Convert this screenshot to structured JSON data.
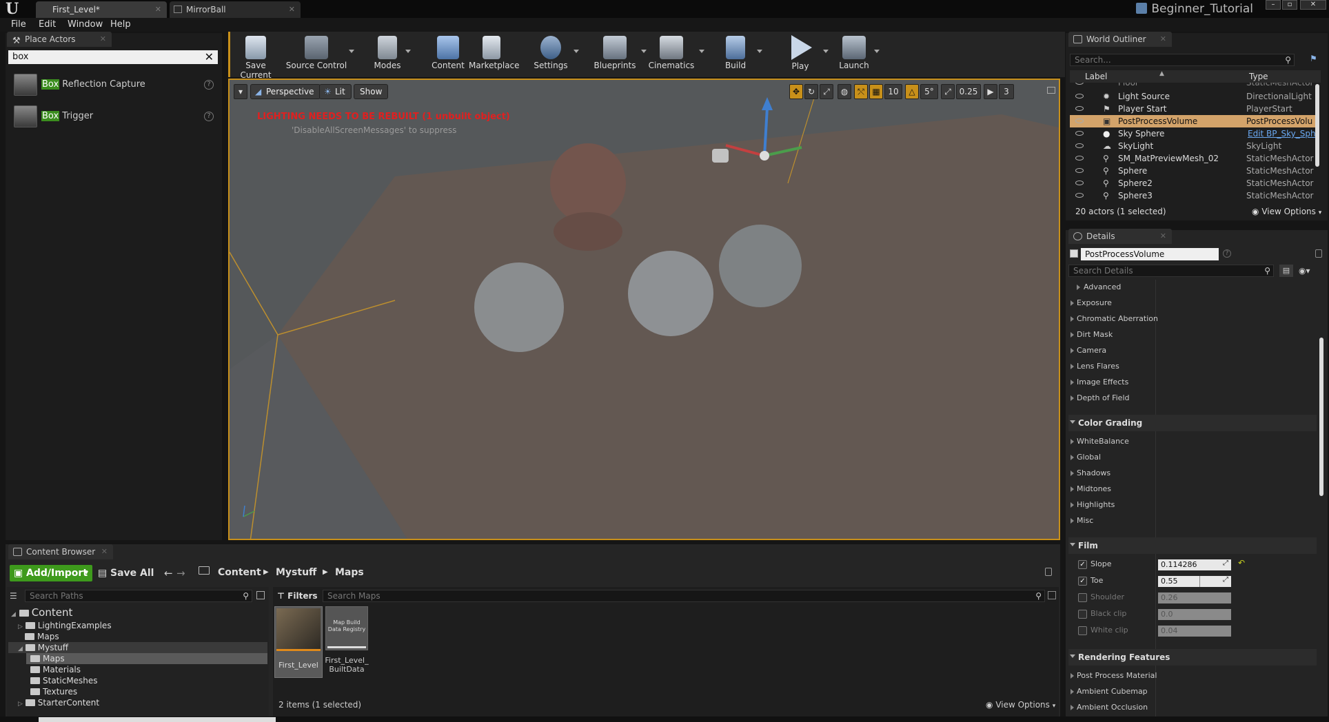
{
  "window": {
    "tabs": [
      {
        "label": "First_Level*"
      },
      {
        "label": "MirrorBall"
      }
    ],
    "project_name": "Beginner_Tutorial"
  },
  "menu": [
    "File",
    "Edit",
    "Window",
    "Help"
  ],
  "place_actors": {
    "tab_label": "Place Actors",
    "search_value": "box",
    "items": [
      {
        "highlight": "Box",
        "rest": " Reflection Capture"
      },
      {
        "highlight": "Box",
        "rest": " Trigger"
      }
    ]
  },
  "toolbar": {
    "buttons": [
      "Save Current",
      "Source Control",
      "Modes",
      "Content",
      "Marketplace",
      "Settings",
      "Blueprints",
      "Cinematics",
      "Build",
      "Play",
      "Launch"
    ]
  },
  "viewport": {
    "perspective_label": "Perspective",
    "lit_label": "Lit",
    "show_label": "Show",
    "warning": "LIGHTING NEEDS TO BE REBUILT (1 unbuilt object)",
    "suppress_hint": "'DisableAllScreenMessages' to suppress",
    "grid_snap": "10",
    "rotation_snap": "5°",
    "scale_snap": "0.25",
    "camera_speed": "3"
  },
  "content_browser": {
    "tab_label": "Content Browser",
    "add_import_label": "Add/Import",
    "save_all_label": "Save All",
    "breadcrumb": [
      "Content",
      "Mystuff",
      "Maps"
    ],
    "search_paths_placeholder": "Search Paths",
    "filters_label": "Filters",
    "search_maps_placeholder": "Search Maps",
    "tree": [
      {
        "label": "Content",
        "depth": 0
      },
      {
        "label": "LightingExamples",
        "depth": 1
      },
      {
        "label": "Maps",
        "depth": 1
      },
      {
        "label": "Mystuff",
        "depth": 1
      },
      {
        "label": "Maps",
        "depth": 2
      },
      {
        "label": "Materials",
        "depth": 2
      },
      {
        "label": "StaticMeshes",
        "depth": 2
      },
      {
        "label": "Textures",
        "depth": 2
      },
      {
        "label": "StarterContent",
        "depth": 1
      }
    ],
    "assets": [
      {
        "name": "First_Level"
      },
      {
        "thumb_label": "Map Build Data Registry",
        "name": "First_Level_ BuiltData"
      }
    ],
    "item_count": "2 items (1 selected)",
    "view_options_label": "View Options"
  },
  "world_outliner": {
    "tab_label": "World Outliner",
    "search_placeholder": "Search...",
    "col_label": "Label",
    "col_type": "Type",
    "rows": [
      {
        "label": "Floor",
        "type": "StaticMeshActor"
      },
      {
        "label": "Light Source",
        "type": "DirectionalLight"
      },
      {
        "label": "Player Start",
        "type": "PlayerStart"
      },
      {
        "label": "PostProcessVolume",
        "type": "PostProcessVolu"
      },
      {
        "label": "Sky Sphere",
        "type": "Edit BP_Sky_Sph"
      },
      {
        "label": "SkyLight",
        "type": "SkyLight"
      },
      {
        "label": "SM_MatPreviewMesh_02",
        "type": "StaticMeshActor"
      },
      {
        "label": "Sphere",
        "type": "StaticMeshActor"
      },
      {
        "label": "Sphere2",
        "type": "StaticMeshActor"
      },
      {
        "label": "Sphere3",
        "type": "StaticMeshActor"
      }
    ],
    "footer": "20 actors (1 selected)",
    "view_options_label": "View Options"
  },
  "details": {
    "tab_label": "Details",
    "object_name": "PostProcessVolume",
    "search_placeholder": "Search Details",
    "items_top": [
      "Advanced",
      "Exposure",
      "Chromatic Aberration",
      "Dirt Mask",
      "Camera",
      "Lens Flares",
      "Image Effects",
      "Depth of Field"
    ],
    "color_grading_label": "Color Grading",
    "color_grading_items": [
      "WhiteBalance",
      "Global",
      "Shadows",
      "Midtones",
      "Highlights",
      "Misc"
    ],
    "film_label": "Film",
    "film_props": [
      {
        "label": "Slope",
        "value": "0.114286",
        "checked": true
      },
      {
        "label": "Toe",
        "value": "0.55",
        "checked": true
      },
      {
        "label": "Shoulder",
        "value": "0.26",
        "checked": false
      },
      {
        "label": "Black clip",
        "value": "0.0",
        "checked": false
      },
      {
        "label": "White clip",
        "value": "0.04",
        "checked": false
      }
    ],
    "rendering_label": "Rendering Features",
    "rendering_items": [
      "Post Process Material",
      "Ambient Cubemap",
      "Ambient Occlusion"
    ]
  }
}
